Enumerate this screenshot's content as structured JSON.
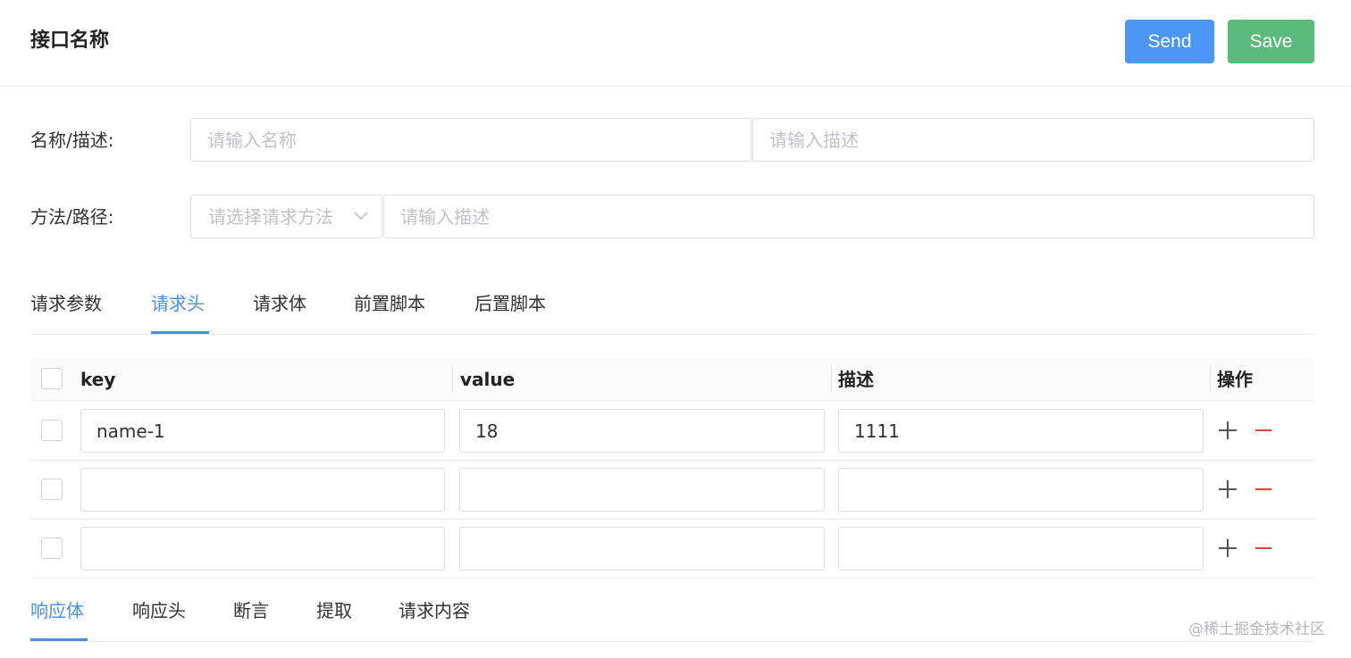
{
  "header": {
    "title": "接口名称",
    "send_label": "Send",
    "save_label": "Save"
  },
  "form": {
    "name_desc_label": "名称/描述:",
    "name_placeholder": "请输入名称",
    "desc_placeholder": "请输入描述",
    "method_path_label": "方法/路径:",
    "method_placeholder": "请选择请求方法",
    "path_placeholder": "请输入描述"
  },
  "request_tabs": [
    {
      "label": "请求参数",
      "active": false
    },
    {
      "label": "请求头",
      "active": true
    },
    {
      "label": "请求体",
      "active": false
    },
    {
      "label": "前置脚本",
      "active": false
    },
    {
      "label": "后置脚本",
      "active": false
    }
  ],
  "table": {
    "columns": [
      "key",
      "value",
      "描述",
      "操作"
    ],
    "rows": [
      {
        "key": "name-1",
        "value": "18",
        "description": "1111"
      },
      {
        "key": "",
        "value": "",
        "description": ""
      },
      {
        "key": "",
        "value": "",
        "description": ""
      }
    ]
  },
  "response_tabs": [
    {
      "label": "响应体",
      "active": true
    },
    {
      "label": "响应头",
      "active": false
    },
    {
      "label": "断言",
      "active": false
    },
    {
      "label": "提取",
      "active": false
    },
    {
      "label": "请求内容",
      "active": false
    }
  ],
  "colors": {
    "primary": "#4c97f5",
    "success": "#5cba7d",
    "danger": "#e0463b",
    "active_tab": "#4a8fe7"
  },
  "icons": {
    "add_row": "plus-icon",
    "remove_row": "minus-icon",
    "select_arrow": "chevron-down-icon"
  },
  "watermark": "@稀土掘金技术社区"
}
